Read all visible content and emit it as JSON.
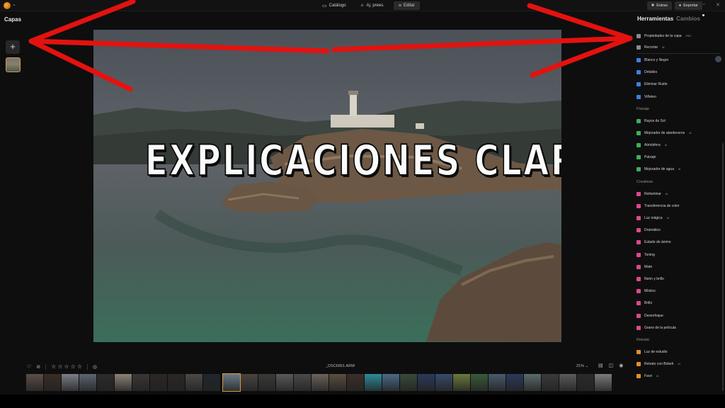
{
  "topbar": {
    "tabs": [
      {
        "label": "Catálogo",
        "icon": "catalog-icon"
      },
      {
        "label": "Aj. prees.",
        "icon": "presets-icon"
      },
      {
        "label": "Editar",
        "icon": "edit-sliders-icon"
      }
    ],
    "extras_label": "Extras",
    "export_label": "Exportar"
  },
  "left_panel": {
    "title": "Capas",
    "add_symbol": "+"
  },
  "photo": {
    "caption": "EXPLICACIONES CLARAS"
  },
  "right_panel": {
    "tabs": [
      "Herramientas",
      "Cambios"
    ],
    "sections": {
      "paisaje": "Paisaje",
      "creativas": "Creativas",
      "retrato": "Retrato"
    },
    "tools_top": [
      {
        "label": "Propiedades de la capa",
        "badge": "PRO",
        "color": "#8a8a8a"
      },
      {
        "label": "Recortar",
        "badge": "AI",
        "color": "#8a8a8a"
      },
      {
        "label": "Blanco y Negro",
        "badge": "",
        "color": "#3b82d6"
      },
      {
        "label": "Detalles",
        "badge": "",
        "color": "#3b82d6"
      },
      {
        "label": "Eliminar Ruido",
        "badge": "",
        "color": "#3b82d6"
      },
      {
        "label": "Viñeteo",
        "badge": "",
        "color": "#3b82d6"
      }
    ],
    "tools_paisaje": [
      {
        "label": "Rayos de Sol",
        "badge": "",
        "color": "#3fae5a"
      },
      {
        "label": "Mejorador de atardeceres",
        "badge": "AI",
        "color": "#3fae5a"
      },
      {
        "label": "Atmósfera",
        "badge": "AI",
        "color": "#3fae5a"
      },
      {
        "label": "Paisaje",
        "badge": "",
        "color": "#3fae5a"
      },
      {
        "label": "Mejorador de agua",
        "badge": "AI",
        "color": "#3fae5a"
      }
    ],
    "tools_creativas": [
      {
        "label": "Reiluminar",
        "badge": "AI",
        "color": "#d94a8a"
      },
      {
        "label": "Transferencia de color",
        "badge": "",
        "color": "#d94a8a"
      },
      {
        "label": "Luz mágica",
        "badge": "AI",
        "color": "#d94a8a"
      },
      {
        "label": "Dramático",
        "badge": "",
        "color": "#d94a8a"
      },
      {
        "label": "Estado de ánimo",
        "badge": "",
        "color": "#d94a8a"
      },
      {
        "label": "Toning",
        "badge": "",
        "color": "#d94a8a"
      },
      {
        "label": "Mate",
        "badge": "",
        "color": "#d94a8a"
      },
      {
        "label": "Neón y brillo",
        "badge": "",
        "color": "#d94a8a"
      },
      {
        "label": "Místico",
        "badge": "",
        "color": "#d94a8a"
      },
      {
        "label": "Brillo",
        "badge": "",
        "color": "#d94a8a"
      },
      {
        "label": "Desenfoque",
        "badge": "",
        "color": "#d94a8a"
      },
      {
        "label": "Grano de la película",
        "badge": "",
        "color": "#d94a8a"
      }
    ],
    "tools_retrato": [
      {
        "label": "Luz de estudio",
        "badge": "",
        "color": "#e0902e"
      },
      {
        "label": "Retrato con Bokeh",
        "badge": "AI",
        "color": "#e0902e"
      },
      {
        "label": "Face",
        "badge": "AI",
        "color": "#e0902e"
      }
    ]
  },
  "bottom_bar": {
    "filename": "_DSC6661.ARW",
    "zoom": "21%",
    "film_colors": [
      "#5a4e46",
      "#3a2c26",
      "#7a7f86",
      "#5c6470",
      "#2c2a2a",
      "#8a8276",
      "#3a3634",
      "#2a2624",
      "#2a2624",
      "#4a4a48",
      "#20262c",
      "#6a7a86",
      "#4a4440",
      "#3a3a38",
      "#585a5a",
      "#4a4a48",
      "#6a625a",
      "#5a4e40",
      "#3a2e2a",
      "#2e8a9a",
      "#4a6a84",
      "#3a4a3a",
      "#2a3a5a",
      "#384a6a",
      "#6a7a3a",
      "#3a5a3a",
      "#4a5a6a",
      "#2a3a5a",
      "#5a6a6a",
      "#3a3a3a",
      "#5a5a5a",
      "#2a2a2a",
      "#7a7a7a"
    ]
  }
}
